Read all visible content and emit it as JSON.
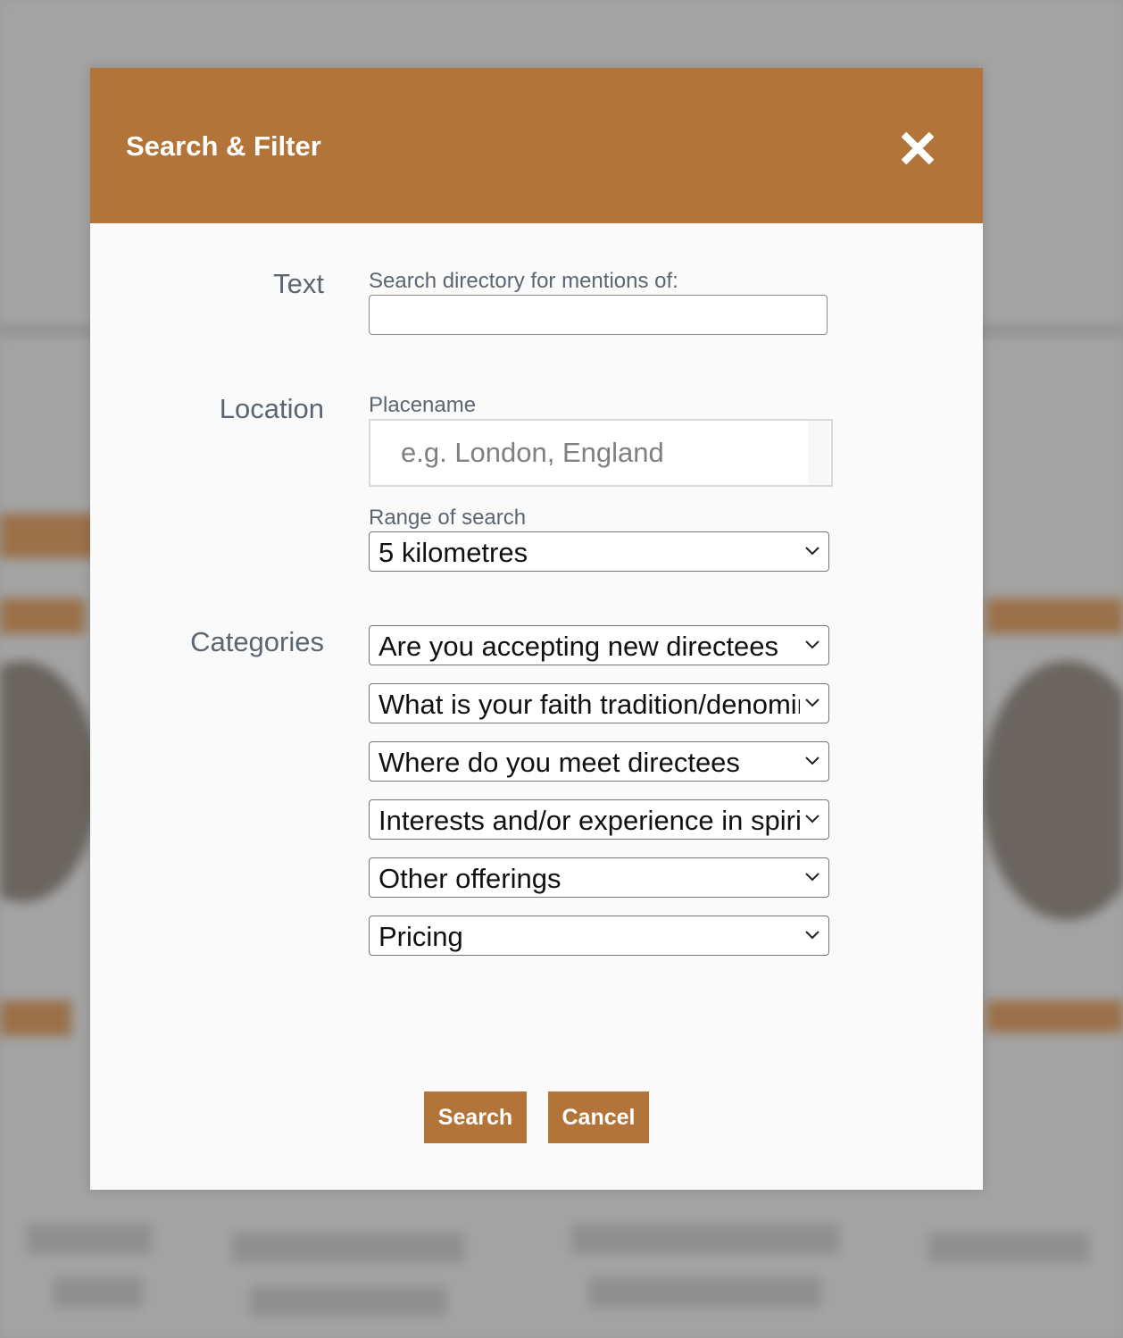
{
  "modal": {
    "title": "Search & Filter",
    "close_icon": "close-icon"
  },
  "text_section": {
    "label": "Text",
    "field_label": "Search directory for mentions of:",
    "value": ""
  },
  "location_section": {
    "label": "Location",
    "placename_label": "Placename",
    "placename_placeholder": "e.g. London, England",
    "range_label": "Range of search",
    "range_value": "5 kilometres"
  },
  "categories_section": {
    "label": "Categories",
    "selects": [
      "Are you accepting new directees",
      "What is your faith tradition/denomination",
      "Where do you meet directees",
      "Interests and/or experience in spiritual direction",
      "Other offerings",
      "Pricing"
    ]
  },
  "actions": {
    "search_label": "Search",
    "cancel_label": "Cancel"
  },
  "colors": {
    "accent": "#b27439",
    "overlay": "#9c9c9c",
    "label_text": "#5c6670"
  }
}
